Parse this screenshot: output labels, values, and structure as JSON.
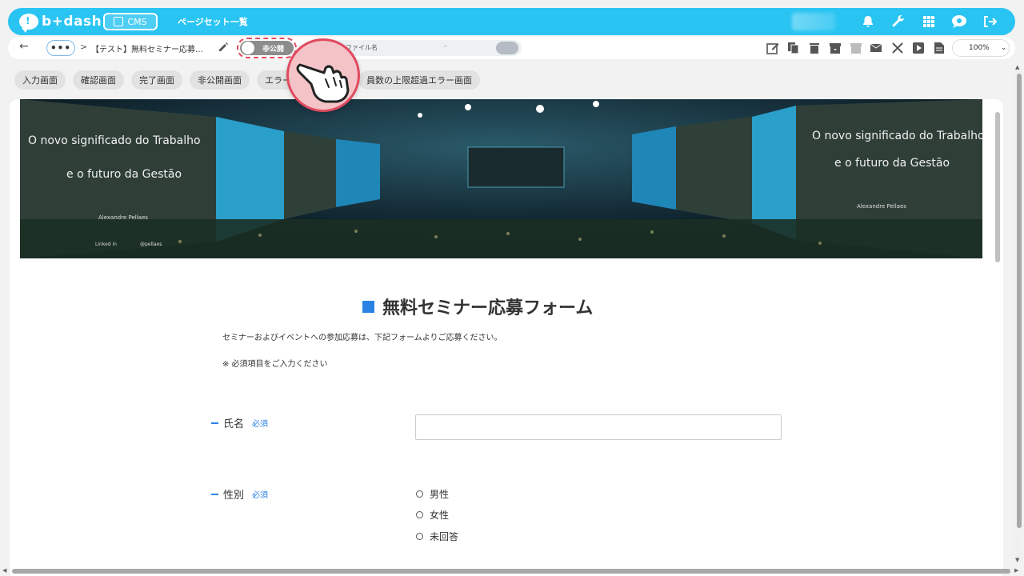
{
  "app": {
    "logo_text": "b+dash",
    "cms_chip": "CMS",
    "page_title": "ページセット一覧"
  },
  "toolbar": {
    "breadcrumb": "【テスト】無料セミナー応募…",
    "toggle_label": "非公開",
    "filename_label": "ファイル名",
    "filename_value": "-",
    "zoom": "100%"
  },
  "tabs": [
    "入力画面",
    "確認画面",
    "完了画面",
    "非公開画面",
    "エラー",
    "員数の上限超過エラー画面"
  ],
  "hero": {
    "left_line1": "O novo significado do Trabalho",
    "left_line2": "e o futuro da Gestão",
    "left_presenter": "Alexandre Pellaes",
    "right_line1": "O novo significado do Trabalho",
    "right_line2": "e o futuro da Gestão",
    "right_presenter": "Alexandre Pellaes",
    "social": "Linked in",
    "handle": "@pellaes"
  },
  "form": {
    "title": "無料セミナー応募フォーム",
    "description": "セミナーおよびイベントへの参加応募は、下記フォームよりご応募ください。",
    "required_note": "※ 必須項目をご入力ください",
    "required_badge": "必須",
    "name_label": "氏名",
    "gender_label": "性別",
    "gender_options": [
      "男性",
      "女性",
      "未回答"
    ]
  },
  "colors": {
    "topbar": "#29c4f2",
    "accent": "#2a82e4",
    "highlight": "#e04a5f"
  }
}
